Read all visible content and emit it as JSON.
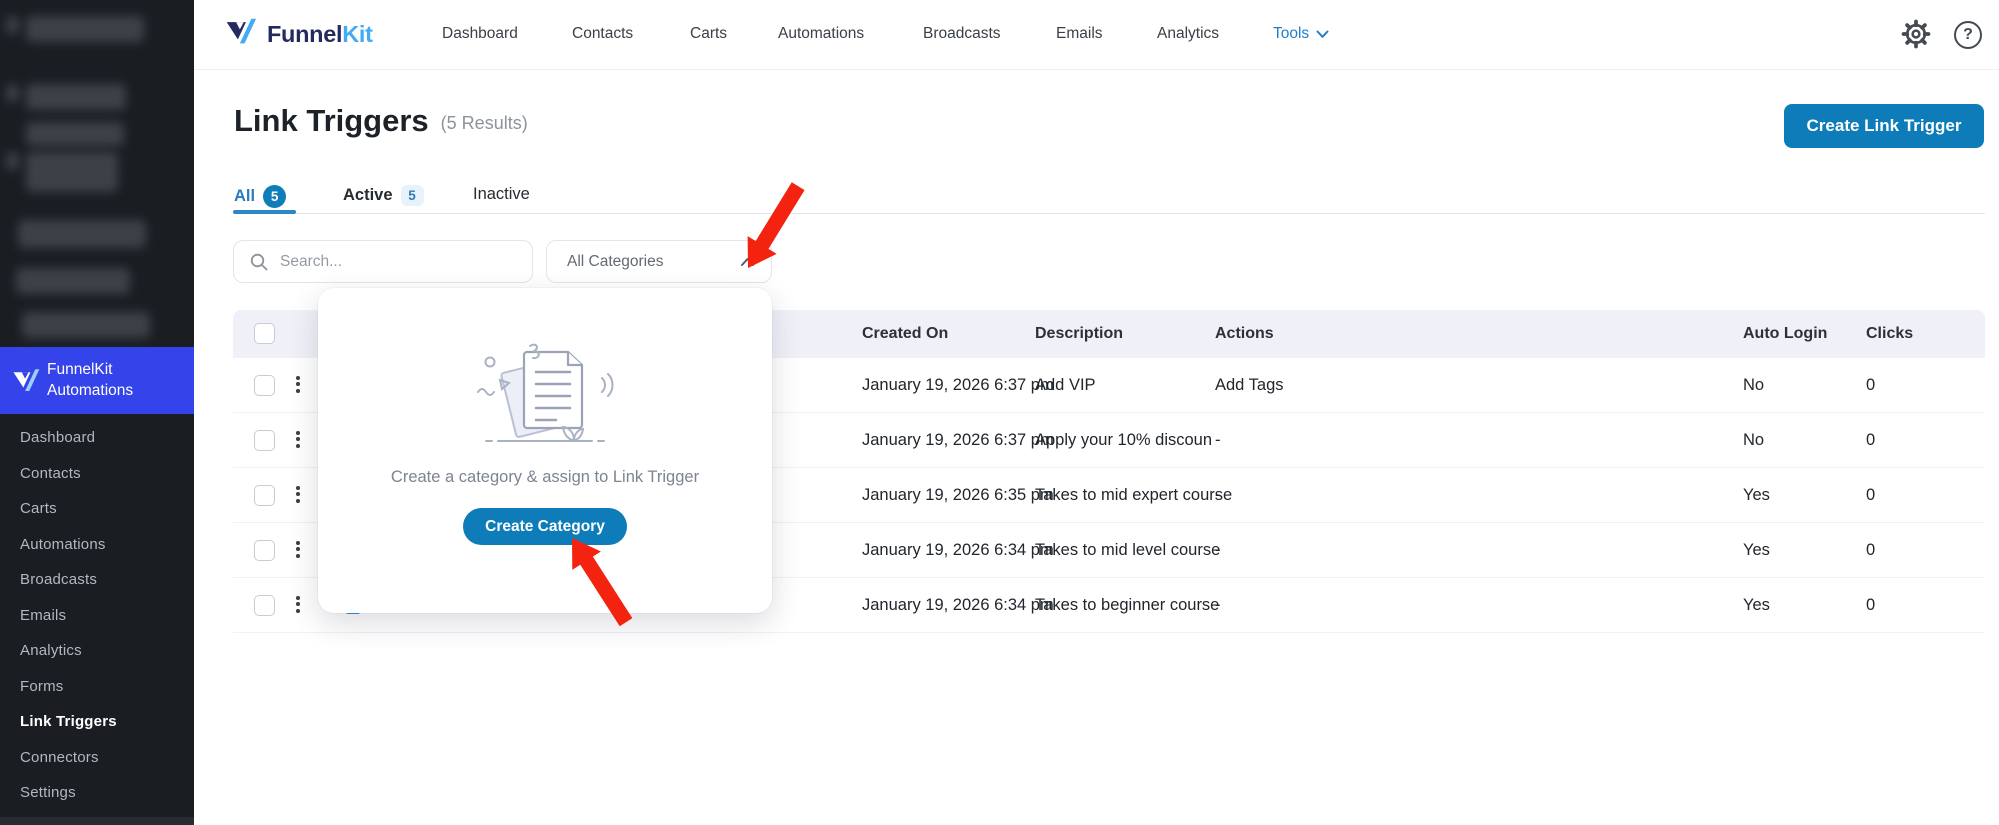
{
  "brand": {
    "name_part1": "Funnel",
    "name_part2": "Kit"
  },
  "topnav": {
    "items": [
      "Dashboard",
      "Contacts",
      "Carts",
      "Automations",
      "Broadcasts",
      "Emails",
      "Analytics"
    ],
    "tools": "Tools"
  },
  "icons": {
    "help_glyph": "?"
  },
  "page": {
    "title": "Link Triggers",
    "results_count": "(5 Results)",
    "create_button": "Create Link Trigger"
  },
  "tabs": {
    "all_label": "All",
    "all_count": "5",
    "active_label": "Active",
    "active_count": "5",
    "inactive_label": "Inactive"
  },
  "filters": {
    "search_placeholder": "Search...",
    "category_filter": "All Categories"
  },
  "category_popover": {
    "message": "Create a category & assign to Link Trigger",
    "create_button": "Create Category"
  },
  "table": {
    "columns": {
      "created_on": "Created On",
      "description": "Description",
      "actions": "Actions",
      "auto_login": "Auto Login",
      "clicks": "Clicks"
    },
    "rows": [
      {
        "created_on": "January 19, 2026 6:37 pm",
        "description": "Add VIP",
        "actions": "Add Tags",
        "auto_login": "No",
        "clicks": "0"
      },
      {
        "created_on": "January 19, 2026 6:37 pm",
        "description": "Apply your 10% discoun",
        "actions": "-",
        "auto_login": "No",
        "clicks": "0"
      },
      {
        "created_on": "January 19, 2026 6:35 pm",
        "description": "Takes to mid expert course",
        "actions": "-",
        "auto_login": "Yes",
        "clicks": "0"
      },
      {
        "created_on": "January 19, 2026 6:34 pm",
        "description": "Takes to mid level course",
        "actions": "-",
        "auto_login": "Yes",
        "clicks": "0"
      },
      {
        "created_on": "January 19, 2026 6:34 pm",
        "description": "Takes to beginner course",
        "actions": "-",
        "auto_login": "Yes",
        "clicks": "0"
      }
    ]
  },
  "sidebar": {
    "plugin_line1": "FunnelKit",
    "plugin_line2": "Automations",
    "items": [
      "Dashboard",
      "Contacts",
      "Carts",
      "Automations",
      "Broadcasts",
      "Emails",
      "Analytics",
      "Forms",
      "Link Triggers",
      "Connectors",
      "Settings"
    ],
    "active_item": "Link Triggers"
  },
  "colors": {
    "primary_button": "#0d7cb8",
    "brand_navy": "#252a5e",
    "brand_blue": "#43aaf3",
    "sidebar_active": "#3443ea",
    "table_header_bg": "#f0f1f8",
    "tab_active_blue": "#2b7bbd",
    "annotation_arrow_red": "#f3230f"
  }
}
